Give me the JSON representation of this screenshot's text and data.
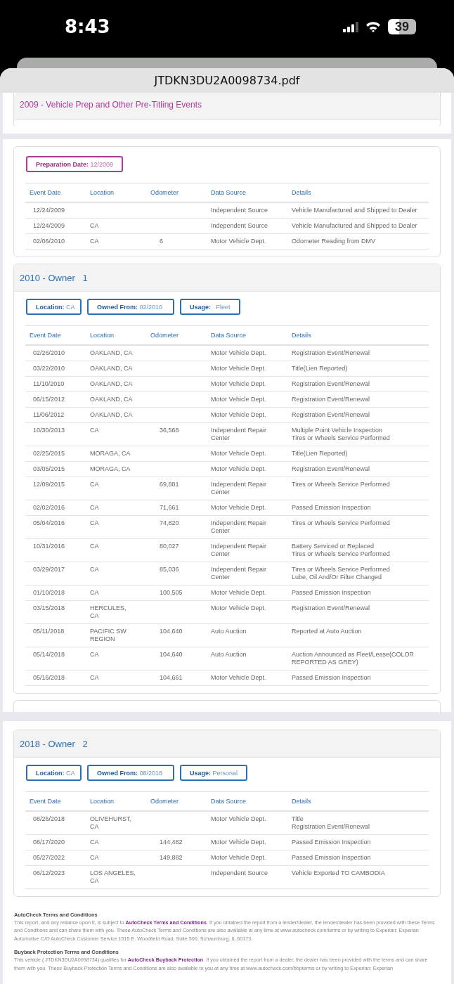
{
  "status_bar": {
    "time": "8:43",
    "battery": "39"
  },
  "document": {
    "title": "JTDKN3DU2A0098734.pdf"
  },
  "prep_header": {
    "title": "2009 - Vehicle Prep and Other Pre-Titling Events"
  },
  "prep": {
    "badges": [
      "**Preparation Date:** 12/2009"
    ],
    "columns": [
      "Event Date",
      "Location",
      "Odometer",
      "Data Source",
      "Details"
    ],
    "rows": [
      [
        "12/24/2009",
        "",
        "",
        "Independent Source",
        "Vehicle Manufactured and Shipped to Dealer"
      ],
      [
        "12/24/2009",
        "CA",
        "",
        "Independent Source",
        "Vehicle Manufactured and Shipped to Dealer"
      ],
      [
        "02/06/2010",
        "CA",
        "6",
        "Motor Vehicle Dept.",
        "Odometer Reading from DMV"
      ]
    ]
  },
  "owners": [
    {
      "title": "2010 - Owner   1",
      "badges": [
        "**Location:** CA",
        "**Owned From:** 02/2010",
        "**Usage:**   Fleet"
      ],
      "columns": [
        "Event Date",
        "Location",
        "Odometer",
        "Data Source",
        "Details"
      ],
      "rows": [
        [
          "02/26/2010",
          "OAKLAND, CA",
          "",
          "Motor Vehicle Dept.",
          "Registration Event/Renewal"
        ],
        [
          "03/22/2010",
          "OAKLAND, CA",
          "",
          "Motor Vehicle Dept.",
          "Title(Lien Reported)"
        ],
        [
          "11/10/2010",
          "OAKLAND, CA",
          "",
          "Motor Vehicle Dept.",
          "Registration Event/Renewal"
        ],
        [
          "06/15/2012",
          "OAKLAND, CA",
          "",
          "Motor Vehicle Dept.",
          "Registration Event/Renewal"
        ],
        [
          "11/06/2012",
          "OAKLAND, CA",
          "",
          "Motor Vehicle Dept.",
          "Registration Event/Renewal"
        ],
        [
          "10/30/2013",
          "CA",
          "36,568",
          "Independent Repair Center",
          "Multiple Point Vehicle Inspection\nTires or Wheels Service Performed"
        ],
        [
          "02/25/2015",
          "MORAGA, CA",
          "",
          "Motor Vehicle Dept.",
          "Title(Lien Reported)"
        ],
        [
          "03/05/2015",
          "MORAGA, CA",
          "",
          "Motor Vehicle Dept.",
          "Registration Event/Renewal"
        ],
        [
          "12/09/2015",
          "CA",
          "69,881",
          "Independent Repair Center",
          "Tires or Wheels Service Performed"
        ],
        [
          "02/02/2016",
          "CA",
          "71,661",
          "Motor Vehicle Dept.",
          "Passed Emission Inspection"
        ],
        [
          "05/04/2016",
          "CA",
          "74,820",
          "Independent Repair Center",
          "Tires or Wheels Service Performed"
        ],
        [
          "10/31/2016",
          "CA",
          "80,027",
          "Independent Repair Center",
          "Battery Serviced or Replaced\nTires or Wheels Service Performed"
        ],
        [
          "03/29/2017",
          "CA",
          "85,036",
          "Independent Repair Center",
          "Tires or Wheels Service Performed\nLube, Oil And/Or Filter Changed"
        ],
        [
          "01/10/2018",
          "CA",
          "100,505",
          "Motor Vehicle Dept.",
          "Passed Emission Inspection"
        ],
        [
          "03/15/2018",
          "HERCULES, CA",
          "",
          "Motor Vehicle Dept.",
          "Registration Event/Renewal"
        ],
        [
          "05/11/2018",
          "PACIFIC SW REGION",
          "104,640",
          "Auto Auction",
          "Reported at Auto Auction"
        ],
        [
          "05/14/2018",
          "CA",
          "104,640",
          "Auto Auction",
          "Auction Announced as Fleet/Lease(COLOR REPORTED AS GREY)"
        ],
        [
          "05/16/2018",
          "CA",
          "104,661",
          "Motor Vehicle Dept.",
          "Passed Emission Inspection"
        ]
      ]
    },
    {
      "title": "2018 - Owner   2",
      "badges": [
        "**Location:** CA",
        "**Owned From:** 08/2018",
        "**Usage:** Personal"
      ],
      "columns": [
        "Event Date",
        "Location",
        "Odometer",
        "Data Source",
        "Details"
      ],
      "rows": [
        [
          "08/26/2018",
          "OLIVEHURST, CA",
          "",
          "Motor Vehicle Dept.",
          "Title\nRegistration Event/Renewal"
        ],
        [
          "08/17/2020",
          "CA",
          "144,482",
          "Motor Vehicle Dept.",
          "Passed Emission Inspection"
        ],
        [
          "05/27/2022",
          "CA",
          "149,882",
          "Motor Vehicle Dept.",
          "Passed Emission Inspection"
        ],
        [
          "06/12/2023",
          "LOS ANGELES, CA",
          "",
          "Independent Source",
          "Vehicle Exported TO CAMBODIA"
        ]
      ]
    }
  ],
  "terms": [
    {
      "heading": "AutoCheck Terms and Conditions",
      "parts": [
        {
          "kind": "text",
          "text": "This report, and any reliance upon it, is subject to "
        },
        {
          "kind": "link",
          "text": "AutoCheck Terms and Conditions"
        },
        {
          "kind": "text",
          "text": ". If you obtained the report from a lender/dealer, the lender/dealer has been provided with these Terms and Conditions and can share them with you. These AutoCheck Terms and Conditions are also available at any time at www.autocheck.com/terms  or by writing to Experian: Experian Automotive C/O AutoCheck Customer Service 1515 E. Woodfield Road, Suite 500, Schaumburg, IL 60173."
        }
      ]
    },
    {
      "heading": "Buyback Protection Terms and Conditions",
      "parts": [
        {
          "kind": "text",
          "text": "This vehicle ( JTDKN3DU2A0098734) qualifies for "
        },
        {
          "kind": "link",
          "text": "AutoCheck Buyback Protection"
        },
        {
          "kind": "text",
          "text": ". If you obtained the report from a dealer, the dealer has been provided with the terms and can share them with you. These Buyback Protection Terms and Conditions are also available to you at any time at www.autocheck.com/bbpterms or by writing to Experian: Experian"
        }
      ]
    }
  ]
}
